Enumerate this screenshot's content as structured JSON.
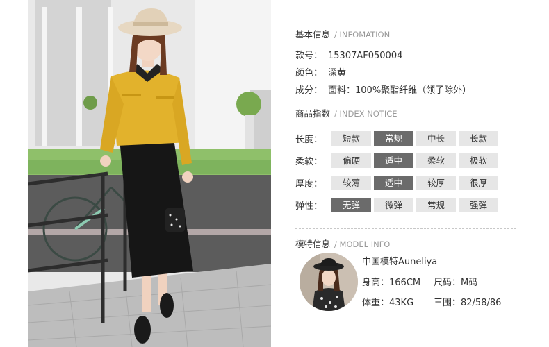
{
  "basic": {
    "title": "基本信息",
    "title_en": "/ INFOMATION",
    "sku_label": "款号：",
    "sku": "15307AF050004",
    "color_label": "颜色：",
    "color": "深黄",
    "composition_label": "成分：",
    "composition": "面料：100%聚酯纤维（领子除外）"
  },
  "index": {
    "title": "商品指数",
    "title_en": "/ INDEX NOTICE",
    "rows": [
      {
        "label": "长度：",
        "options": [
          "短款",
          "常规",
          "中长",
          "长款"
        ],
        "selected": 1
      },
      {
        "label": "柔软：",
        "options": [
          "偏硬",
          "适中",
          "柔软",
          "极软"
        ],
        "selected": 1
      },
      {
        "label": "厚度：",
        "options": [
          "较薄",
          "适中",
          "较厚",
          "很厚"
        ],
        "selected": 1
      },
      {
        "label": "弹性：",
        "options": [
          "无弹",
          "微弹",
          "常规",
          "强弹"
        ],
        "selected": 0
      }
    ]
  },
  "model": {
    "title": "模特信息",
    "title_en": "/ MODEL INFO",
    "name": "中国模特Auneliya",
    "height": "身高：166CM",
    "size": "尺码：M码",
    "weight": "体重：43KG",
    "measurements": "三围：82/58/86"
  }
}
